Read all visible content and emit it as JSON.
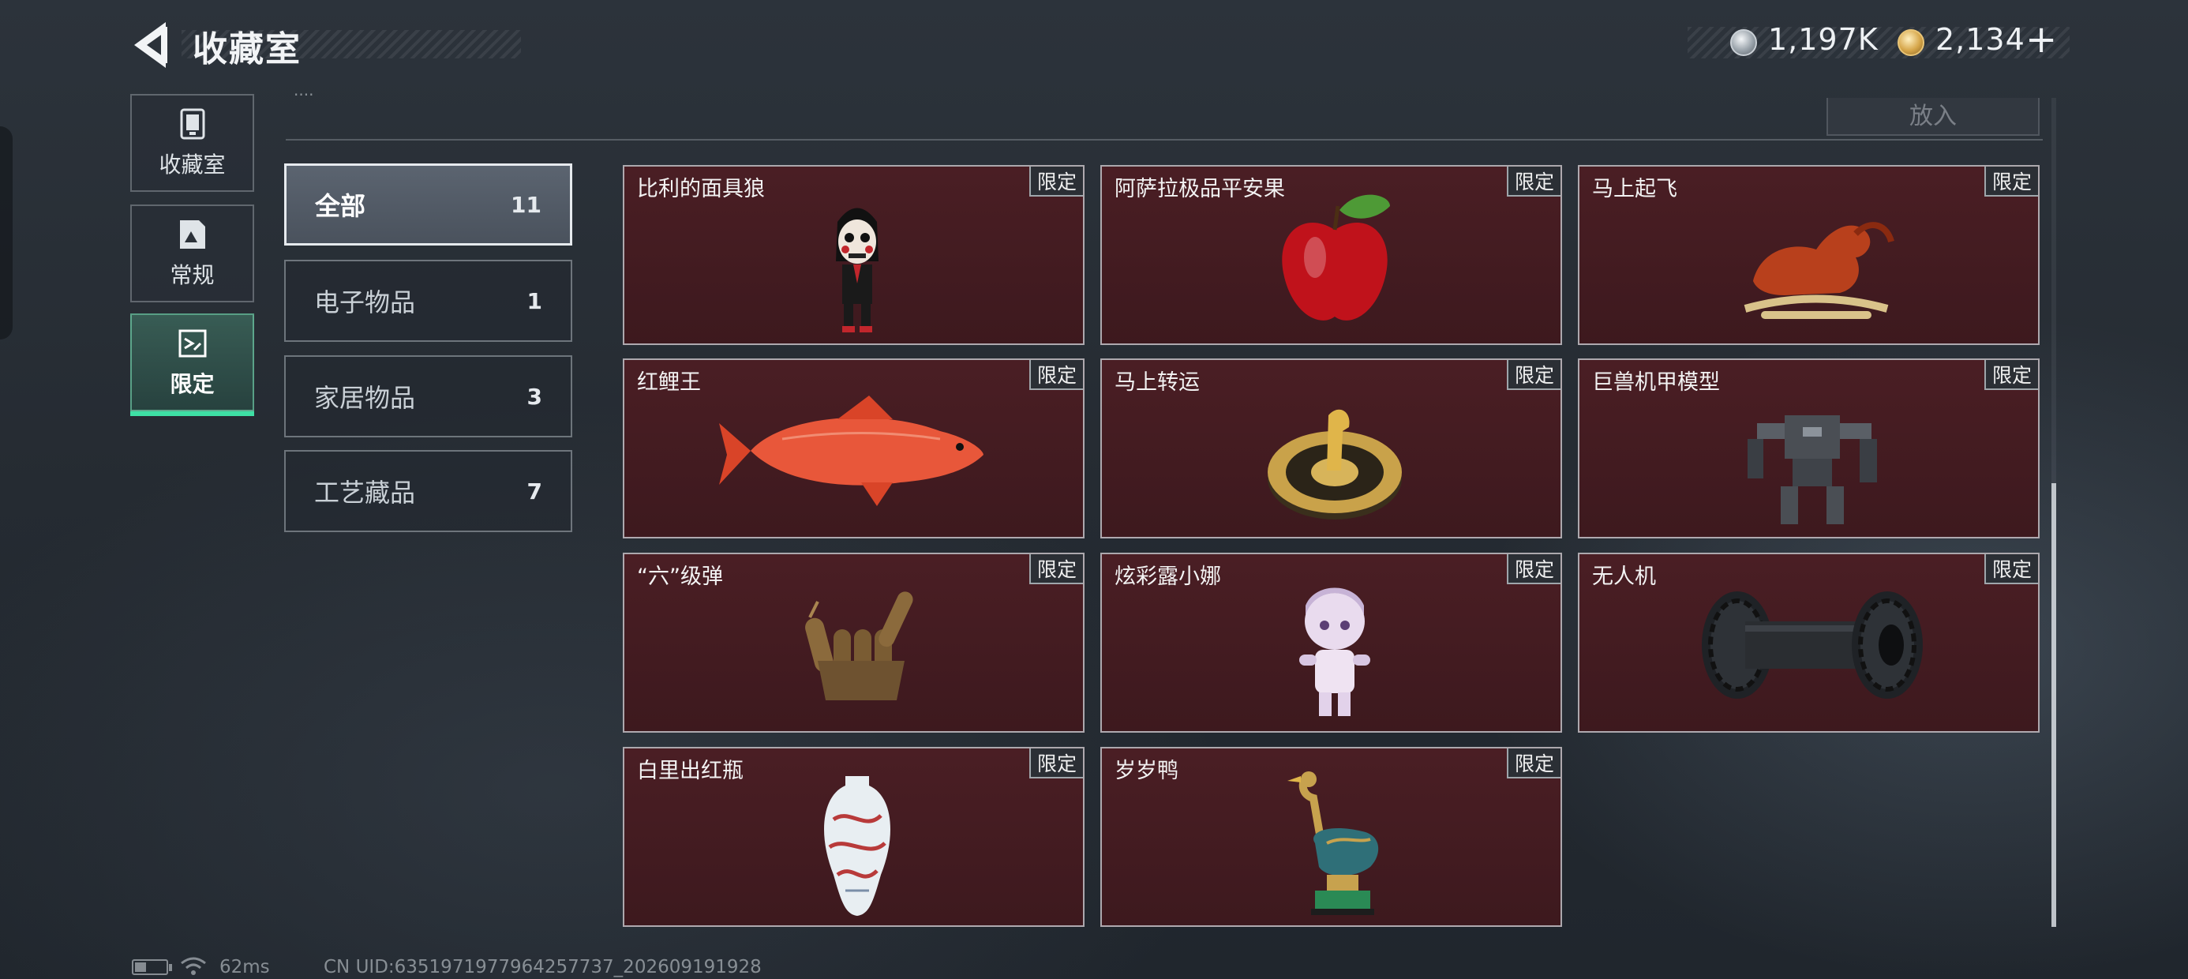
{
  "header": {
    "title": "收藏室",
    "currencies": [
      {
        "icon": "silver-coin-icon",
        "value": "1,197K"
      },
      {
        "icon": "gold-coin-icon",
        "value": "2,134"
      }
    ],
    "add_label": "+"
  },
  "sidebar": {
    "tabs": [
      {
        "label": "收藏室",
        "icon": "collection-room-icon",
        "active": false
      },
      {
        "label": "常规",
        "icon": "frame-icon",
        "active": false
      },
      {
        "label": "限定",
        "icon": "limited-icon",
        "active": true
      }
    ]
  },
  "toolbar": {
    "top_label": "····",
    "put_button_label": "放入"
  },
  "categories": [
    {
      "name": "全部",
      "count": "11",
      "active": true
    },
    {
      "name": "电子物品",
      "count": "1",
      "active": false
    },
    {
      "name": "家居物品",
      "count": "3",
      "active": false
    },
    {
      "name": "工艺藏品",
      "count": "7",
      "active": false
    }
  ],
  "items": [
    {
      "name": "比利的面具狼",
      "tag": "限定",
      "art": "puppet"
    },
    {
      "name": "阿萨拉极品平安果",
      "tag": "限定",
      "art": "apple"
    },
    {
      "name": "马上起飞",
      "tag": "限定",
      "art": "horse"
    },
    {
      "name": "红鲤王",
      "tag": "限定",
      "art": "fish"
    },
    {
      "name": "马上转运",
      "tag": "限定",
      "art": "coin"
    },
    {
      "name": "巨兽机甲模型",
      "tag": "限定",
      "art": "mech"
    },
    {
      "name": "“六”级弹",
      "tag": "限定",
      "art": "hand"
    },
    {
      "name": "炫彩露小娜",
      "tag": "限定",
      "art": "figure"
    },
    {
      "name": "无人机",
      "tag": "限定",
      "art": "drone"
    },
    {
      "name": "白里出红瓶",
      "tag": "限定",
      "art": "vase"
    },
    {
      "name": "岁岁鸭",
      "tag": "限定",
      "art": "duck"
    }
  ],
  "status": {
    "ping": "62ms",
    "uid": "CN UID:6351971977964257737_202609191928"
  }
}
